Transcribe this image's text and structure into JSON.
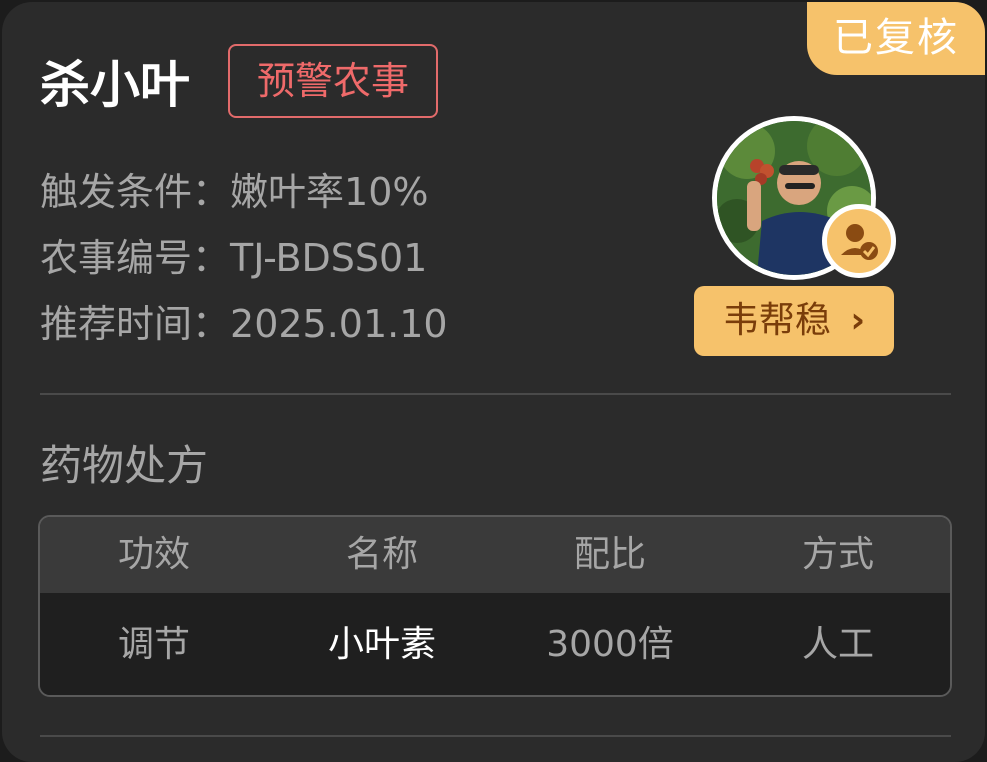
{
  "card": {
    "status_badge": "已复核",
    "title": "杀小叶",
    "tag": "预警农事",
    "info": [
      {
        "label": "触发条件：",
        "value": "嫩叶率10%"
      },
      {
        "label": "农事编号：",
        "value": "TJ-BDSS01"
      },
      {
        "label": "推荐时间：",
        "value": "2025.01.10"
      }
    ],
    "expert": {
      "name": "韦帮稳",
      "chevron": "›",
      "avatar_icon": "person-photo-avatar",
      "verified_icon": "verified-user-icon"
    }
  },
  "prescription": {
    "section_title": "药物处方",
    "headers": [
      "功效",
      "名称",
      "配比",
      "方式"
    ],
    "rows": [
      [
        "调节",
        "小叶素",
        "3000倍",
        "人工"
      ]
    ]
  },
  "colors": {
    "accent": "#f6c26b",
    "warning": "#ef6a6a",
    "card_bg": "#2b2b2b"
  }
}
